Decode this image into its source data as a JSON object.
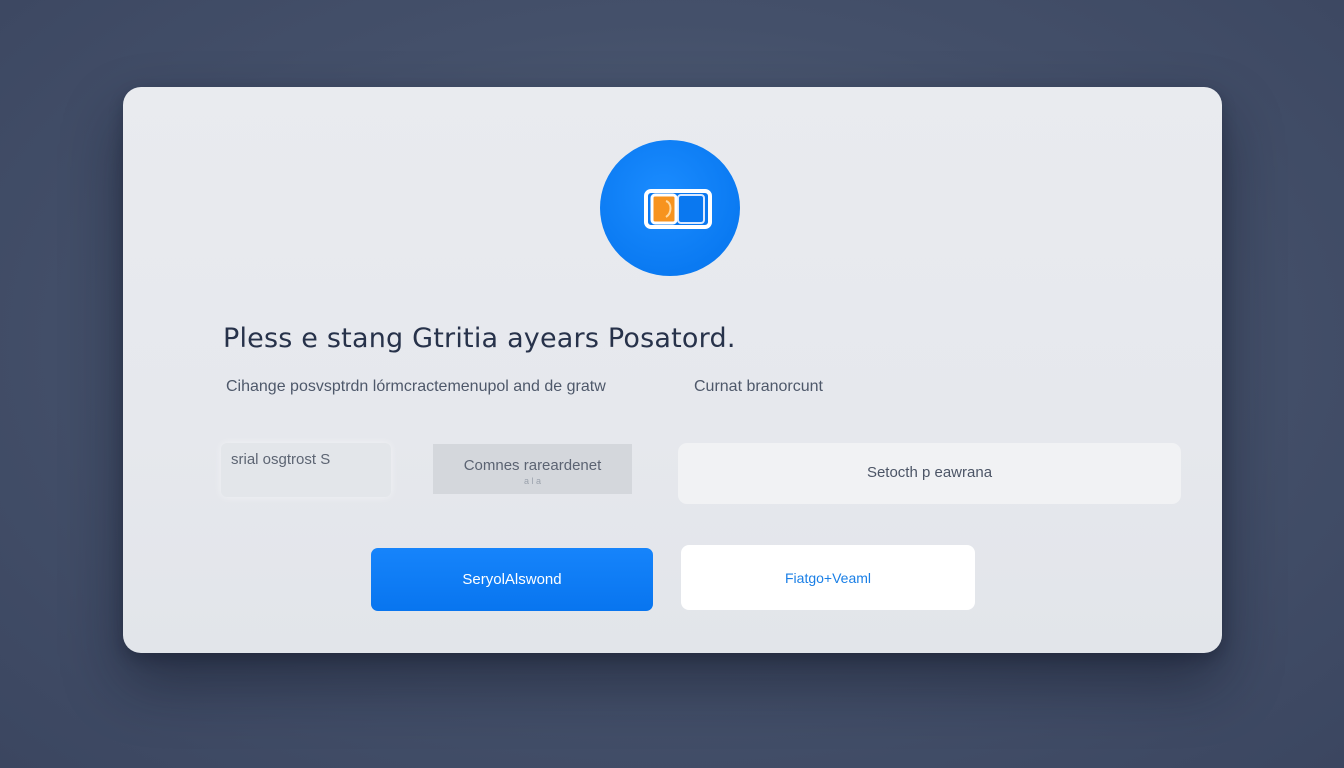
{
  "dialog": {
    "logo_icon": "card-icon",
    "title": "Pless e stang Gtritia ayears Posatord.",
    "subtitle_left": "Cihange posvsptrdn lórmcractemenupol and de gratw",
    "subtitle_right": "Curnat branorcunt",
    "field_a_value": "srial osgtrost S",
    "field_b_value": "Comnes rareardenet",
    "field_b_hint": "a l a",
    "field_c_value": "Setocth p eawrana",
    "primary_button_label": "SeryolAlswond",
    "secondary_button_label": "Fiatgo+Veaml"
  },
  "colors": {
    "accent": "#0a7af2",
    "logo_orange": "#f7931e",
    "background": "#465168",
    "dialog_bg": "#e8eaee"
  }
}
